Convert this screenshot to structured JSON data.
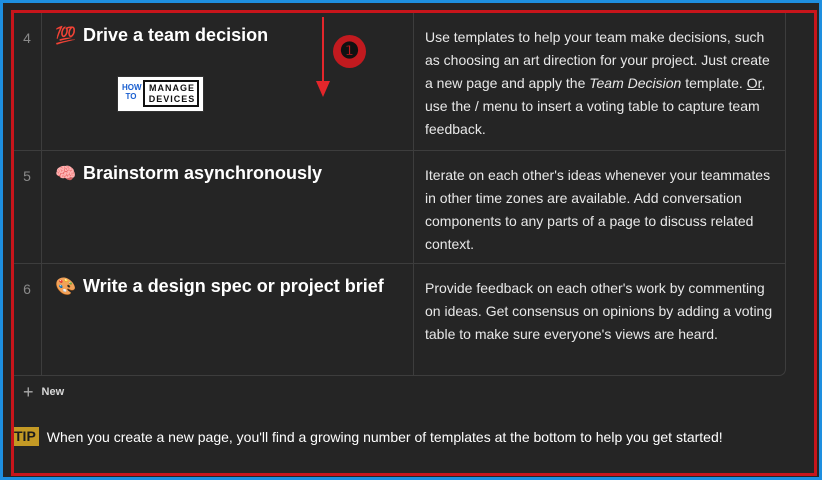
{
  "table": {
    "rows": [
      {
        "number": "4",
        "emoji": "💯",
        "emoji_icon": "hundred-points-icon",
        "title": "Drive a team decision",
        "desc": {
          "part1": "Use templates to help your team make decisions, such as choosing an art direction for your project. Just create a new page and apply the ",
          "italic": "Team Decision",
          "part2": " template. ",
          "underlined": "Or",
          "part3": ", use the / menu to insert a voting table to capture team feedback."
        }
      },
      {
        "number": "5",
        "emoji": "🧠",
        "emoji_icon": "brain-icon",
        "title": "Brainstorm asynchronously",
        "desc": "Iterate on each other's ideas whenever your teammates in other time zones are available. Add conversation components to any parts of a page to discuss related context."
      },
      {
        "number": "6",
        "emoji": "🎨",
        "emoji_icon": "artist-palette-icon",
        "title": "Write a design spec or project brief",
        "desc": "Provide feedback on each other's work by commenting on ideas. Get consensus on opinions by adding a voting table to make sure everyone's views are heard."
      }
    ],
    "new_label": "New"
  },
  "overlay": {
    "callout": "❶",
    "logo": {
      "how": "HOW TO",
      "manage": "MANAGE",
      "devices": "DEVICES"
    }
  },
  "tip": {
    "badge": "TIP",
    "text": "When you create a new page, you'll find a growing number of templates at the bottom to help you get started!"
  },
  "colors": {
    "background": "#252525",
    "annotation_red": "#c8151b",
    "outer_border_blue": "#1e8fe0",
    "tip_badge": "#c49a25"
  }
}
